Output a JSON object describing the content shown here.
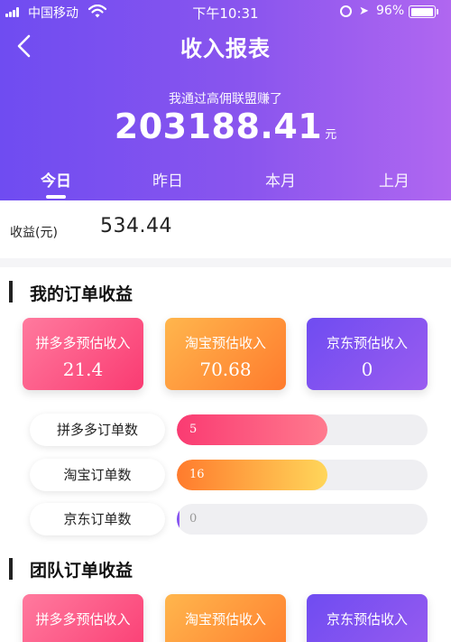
{
  "status": {
    "carrier": "中国移动",
    "time": "下午10:31",
    "battery_pct": "96%",
    "battery_level": 0.96
  },
  "header": {
    "title": "收入报表",
    "earned_label": "我通过高佣联盟赚了",
    "earned_value": "203188.41",
    "earned_unit": "元"
  },
  "tabs": [
    {
      "label": "今日",
      "active": true
    },
    {
      "label": "昨日",
      "active": false
    },
    {
      "label": "本月",
      "active": false
    },
    {
      "label": "上月",
      "active": false
    }
  ],
  "earnings": {
    "label": "收益(元)",
    "value": "534.44"
  },
  "my_orders": {
    "title": "我的订单收益",
    "cards": [
      {
        "label": "拼多多预估收入",
        "value": "21.4"
      },
      {
        "label": "淘宝预估收入",
        "value": "70.68"
      },
      {
        "label": "京东预估收入",
        "value": "0"
      }
    ],
    "counts": [
      {
        "label": "拼多多订单数",
        "value": "5",
        "fill": 0.6
      },
      {
        "label": "淘宝订单数",
        "value": "16",
        "fill": 0.6
      },
      {
        "label": "京东订单数",
        "value": "0",
        "fill": 0
      }
    ]
  },
  "team_orders": {
    "title": "团队订单收益",
    "cards": [
      {
        "label": "拼多多预估收入"
      },
      {
        "label": "淘宝预估收入"
      },
      {
        "label": "京东预估收入"
      }
    ]
  },
  "colors": {
    "header_start": "#6f4cf1",
    "header_end": "#b067f0",
    "pdd": "#fa3b72",
    "taobao": "#ff7b2d",
    "jd": "#6f4cf1"
  },
  "icons": [
    "signal-icon",
    "wifi-icon",
    "rotation-lock-icon",
    "location-icon",
    "battery-icon",
    "back-arrow-icon"
  ]
}
